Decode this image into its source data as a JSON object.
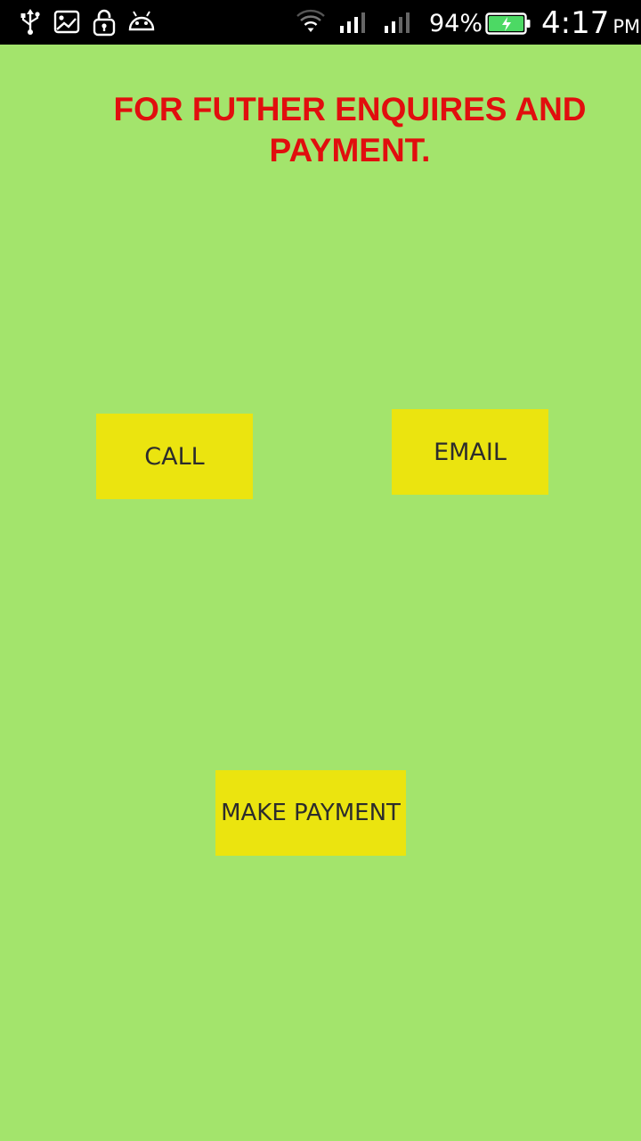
{
  "status_bar": {
    "icons_left": [
      "usb-icon",
      "image-icon",
      "lock-icon",
      "android-debug-icon"
    ],
    "icons_right": [
      "wifi-icon",
      "signal-icon",
      "signal-icon",
      "battery-charging-icon"
    ],
    "battery_percent": "94%",
    "time": "4:17",
    "ampm": "PM"
  },
  "page": {
    "heading": "FOR FUTHER ENQUIRES AND PAYMENT."
  },
  "buttons": {
    "call": "CALL",
    "email": "EMAIL",
    "make_payment": "MAKE PAYMENT"
  },
  "colors": {
    "background": "#a3e46c",
    "heading": "#e10e0e",
    "button": "#ebe40f",
    "battery_fill": "#4cd964"
  }
}
